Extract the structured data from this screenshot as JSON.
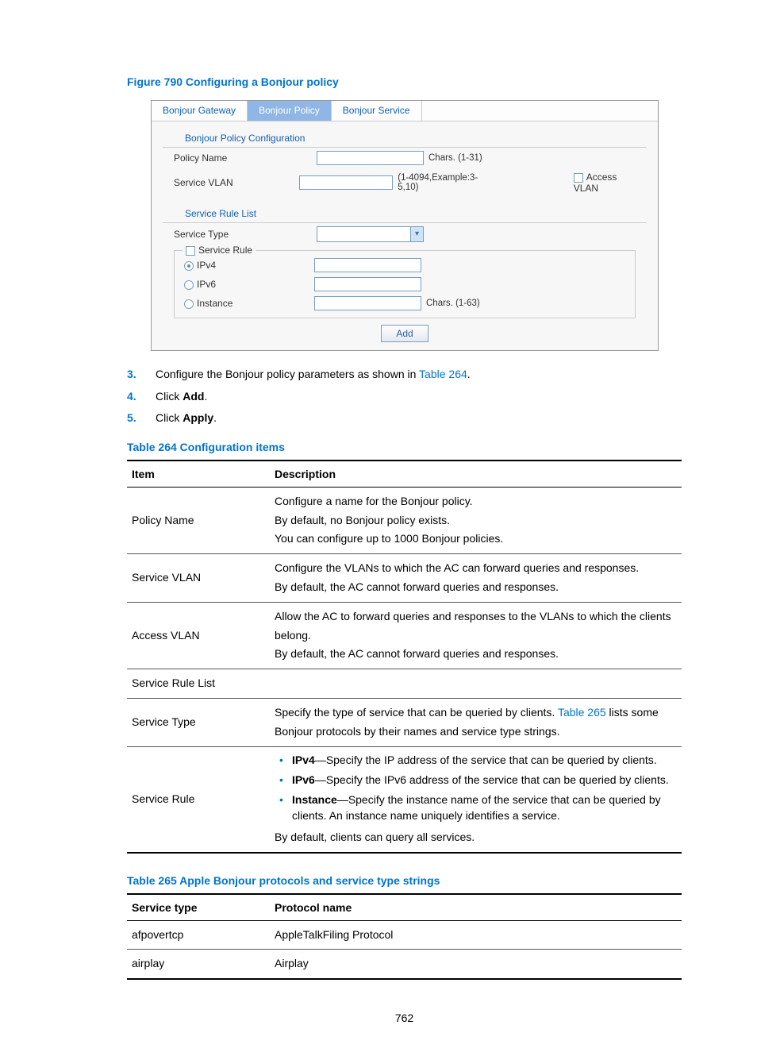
{
  "figure_title": "Figure 790 Configuring a Bonjour policy",
  "panel": {
    "tabs": [
      "Bonjour Gateway",
      "Bonjour Policy",
      "Bonjour Service"
    ],
    "active_tab": 1,
    "section1": "Bonjour Policy Configuration",
    "row_policy_name": "Policy Name",
    "hint_policy_name": "Chars. (1-31)",
    "row_service_vlan": "Service VLAN",
    "hint_service_vlan": "(1-4094,Example:3-5,10)",
    "access_vlan": "Access VLAN",
    "section2": "Service Rule List",
    "row_service_type": "Service Type",
    "service_rule_legend": "Service Rule",
    "radio_ipv4": "IPv4",
    "radio_ipv6": "IPv6",
    "radio_instance": "Instance",
    "hint_instance": "Chars. (1-63)",
    "add_btn": "Add"
  },
  "steps": {
    "s3_prefix": "Configure the Bonjour policy parameters as shown in ",
    "s3_link": "Table 264",
    "s3_suffix": ".",
    "s4_prefix": "Click ",
    "s4_bold": "Add",
    "s4_suffix": ".",
    "s5_prefix": "Click ",
    "s5_bold": "Apply",
    "s5_suffix": "."
  },
  "table264_title": "Table 264 Configuration items",
  "table264": {
    "h1": "Item",
    "h2": "Description",
    "row1_item": "Policy Name",
    "row1_l1": "Configure a name for the Bonjour policy.",
    "row1_l2": "By default, no Bonjour policy exists.",
    "row1_l3": "You can configure up to 1000 Bonjour policies.",
    "row2_item": "Service VLAN",
    "row2_l1": "Configure the VLANs to which the AC can forward queries and responses.",
    "row2_l2": "By default, the AC cannot forward queries and responses.",
    "row3_item": "Access VLAN",
    "row3_l1": "Allow the AC to forward queries and responses to the VLANs to which the clients belong.",
    "row3_l2": "By default, the AC cannot forward queries and responses.",
    "row4_item": "Service Rule List",
    "row5_item": "Service Type",
    "row5_prefix": "Specify the type of service that can be queried by clients. ",
    "row5_link": "Table 265",
    "row5_suffix": " lists some Bonjour protocols by their names and service type strings.",
    "row6_item": "Service Rule",
    "row6_b1_bold": "IPv4",
    "row6_b1_rest": "—Specify the IP address of the service that can be queried by clients.",
    "row6_b2_bold": "IPv6",
    "row6_b2_rest": "—Specify the IPv6 address of the service that can be queried by clients.",
    "row6_b3_bold": "Instance",
    "row6_b3_rest": "—Specify the instance name of the service that can be queried by clients. An instance name uniquely identifies a service.",
    "row6_l2": "By default, clients can query all services."
  },
  "table265_title": "Table 265 Apple Bonjour protocols and service type strings",
  "table265": {
    "h1": "Service type",
    "h2": "Protocol name",
    "r1c1": "afpovertcp",
    "r1c2": "AppleTalkFiling Protocol",
    "r2c1": "airplay",
    "r2c2": "Airplay"
  },
  "page_num": "762"
}
